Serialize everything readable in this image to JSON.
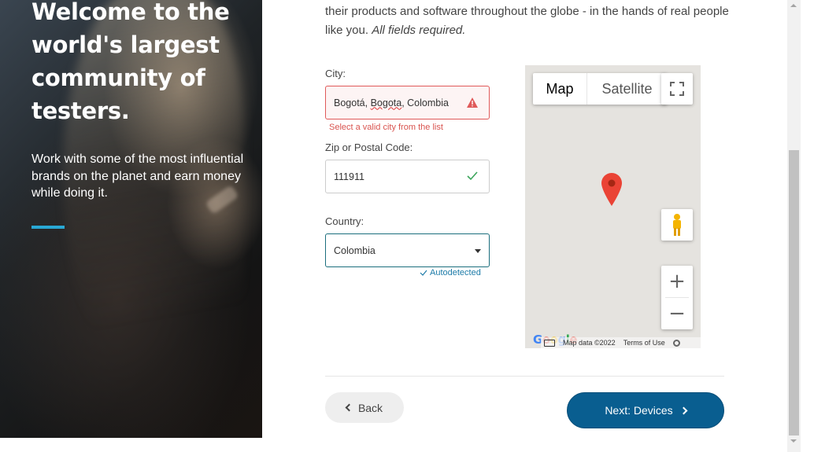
{
  "hero": {
    "title": "Welcome to the world's largest community of testers.",
    "subtitle": "Work with some of the most influential brands on the planet and earn money while doing it.",
    "accent_color": "#29a8d4"
  },
  "intro": {
    "text": "their products and software throughout the globe - in the hands of real people like you.",
    "note": "All fields required."
  },
  "form": {
    "city": {
      "label": "City:",
      "value_part1": "Bogotá, ",
      "value_misspelled": "Bogota",
      "value_part2": ", Colombia",
      "error": "Select a valid city from the list",
      "status_icon": "warning-icon"
    },
    "zip": {
      "label": "Zip or Postal Code:",
      "value": "111911",
      "status_icon": "check-icon"
    },
    "country": {
      "label": "Country:",
      "selected": "Colombia",
      "hint": "Autodetected"
    }
  },
  "map": {
    "tabs": [
      {
        "label": "Map",
        "active": true
      },
      {
        "label": "Satellite",
        "active": false
      }
    ],
    "fullscreen_icon": "fullscreen-icon",
    "pegman_icon": "pegman-icon",
    "zoom_in": "+",
    "zoom_out": "−",
    "attribution": "Map data ©2022",
    "terms": "Terms of Use",
    "logo": "Google",
    "marker_color": "#ea4335"
  },
  "nav": {
    "back": "Back",
    "next": "Next: Devices",
    "next_color": "#095e90"
  }
}
